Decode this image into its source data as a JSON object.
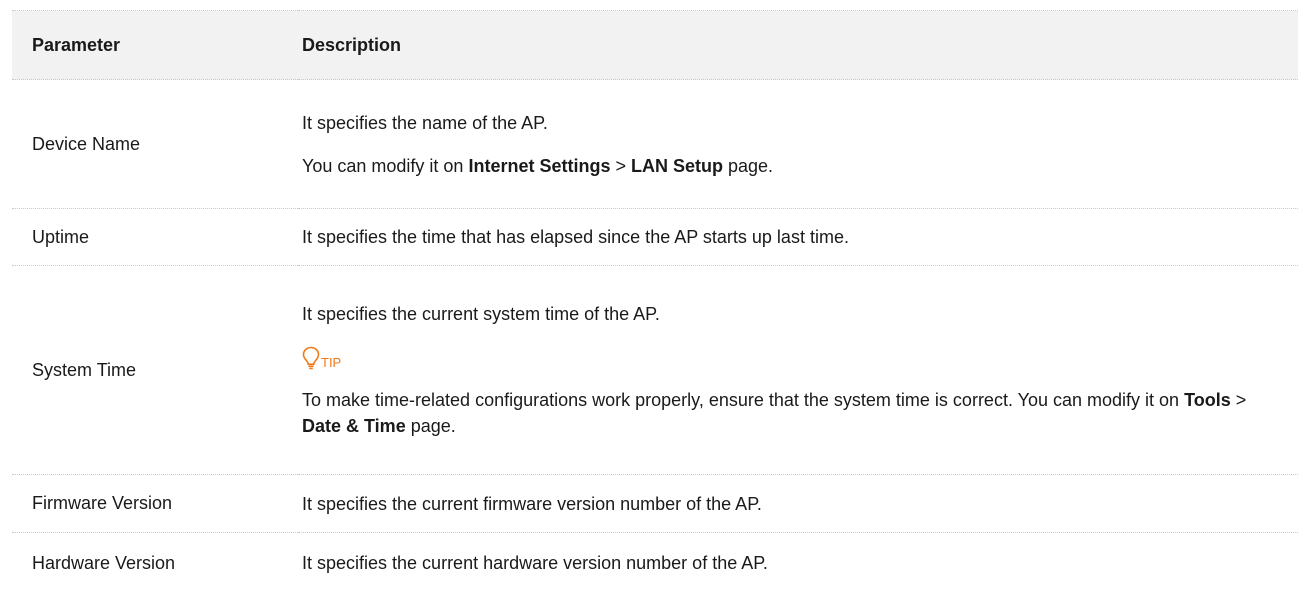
{
  "table": {
    "headers": {
      "parameter": "Parameter",
      "description": "Description"
    },
    "rows": {
      "device_name": {
        "parameter": "Device Name",
        "line1": "It specifies the name of the AP.",
        "line2_prefix": "You can modify it on ",
        "line2_bold1": "Internet Settings",
        "line2_sep": " > ",
        "line2_bold2": "LAN Setup",
        "line2_suffix": " page."
      },
      "uptime": {
        "parameter": "Uptime",
        "description": "It specifies the time that has elapsed since the AP starts up last time."
      },
      "system_time": {
        "parameter": "System Time",
        "line1": "It specifies the current system time of the AP.",
        "tip_icon": "lightbulb-icon",
        "tip_label": "TIP",
        "tip_text_a": "To make time-related configurations work properly, ensure that the system time is correct. You can modify it on ",
        "tip_bold1": "Tools",
        "tip_sep": " > ",
        "tip_bold2": "Date & Time",
        "tip_suffix": " page."
      },
      "firmware_version": {
        "parameter": "Firmware Version",
        "description": "It specifies the current firmware version number of the AP."
      },
      "hardware_version": {
        "parameter": "Hardware Version",
        "description": "It specifies the current hardware version number of the AP."
      }
    }
  },
  "colors": {
    "header_bg": "#f2f2f2",
    "tip_orange": "#f07a1a",
    "border": "#c9c9c9"
  }
}
